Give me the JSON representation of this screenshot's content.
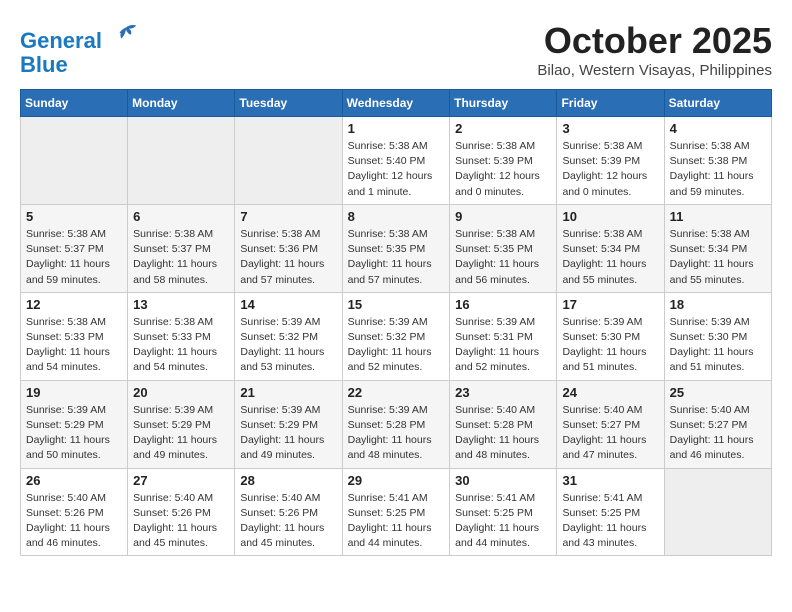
{
  "header": {
    "logo_line1": "General",
    "logo_line2": "Blue",
    "month": "October 2025",
    "location": "Bilao, Western Visayas, Philippines"
  },
  "weekdays": [
    "Sunday",
    "Monday",
    "Tuesday",
    "Wednesday",
    "Thursday",
    "Friday",
    "Saturday"
  ],
  "weeks": [
    [
      {
        "day": "",
        "info": ""
      },
      {
        "day": "",
        "info": ""
      },
      {
        "day": "",
        "info": ""
      },
      {
        "day": "1",
        "info": "Sunrise: 5:38 AM\nSunset: 5:40 PM\nDaylight: 12 hours\nand 1 minute."
      },
      {
        "day": "2",
        "info": "Sunrise: 5:38 AM\nSunset: 5:39 PM\nDaylight: 12 hours\nand 0 minutes."
      },
      {
        "day": "3",
        "info": "Sunrise: 5:38 AM\nSunset: 5:39 PM\nDaylight: 12 hours\nand 0 minutes."
      },
      {
        "day": "4",
        "info": "Sunrise: 5:38 AM\nSunset: 5:38 PM\nDaylight: 11 hours\nand 59 minutes."
      }
    ],
    [
      {
        "day": "5",
        "info": "Sunrise: 5:38 AM\nSunset: 5:37 PM\nDaylight: 11 hours\nand 59 minutes."
      },
      {
        "day": "6",
        "info": "Sunrise: 5:38 AM\nSunset: 5:37 PM\nDaylight: 11 hours\nand 58 minutes."
      },
      {
        "day": "7",
        "info": "Sunrise: 5:38 AM\nSunset: 5:36 PM\nDaylight: 11 hours\nand 57 minutes."
      },
      {
        "day": "8",
        "info": "Sunrise: 5:38 AM\nSunset: 5:35 PM\nDaylight: 11 hours\nand 57 minutes."
      },
      {
        "day": "9",
        "info": "Sunrise: 5:38 AM\nSunset: 5:35 PM\nDaylight: 11 hours\nand 56 minutes."
      },
      {
        "day": "10",
        "info": "Sunrise: 5:38 AM\nSunset: 5:34 PM\nDaylight: 11 hours\nand 55 minutes."
      },
      {
        "day": "11",
        "info": "Sunrise: 5:38 AM\nSunset: 5:34 PM\nDaylight: 11 hours\nand 55 minutes."
      }
    ],
    [
      {
        "day": "12",
        "info": "Sunrise: 5:38 AM\nSunset: 5:33 PM\nDaylight: 11 hours\nand 54 minutes."
      },
      {
        "day": "13",
        "info": "Sunrise: 5:38 AM\nSunset: 5:33 PM\nDaylight: 11 hours\nand 54 minutes."
      },
      {
        "day": "14",
        "info": "Sunrise: 5:39 AM\nSunset: 5:32 PM\nDaylight: 11 hours\nand 53 minutes."
      },
      {
        "day": "15",
        "info": "Sunrise: 5:39 AM\nSunset: 5:32 PM\nDaylight: 11 hours\nand 52 minutes."
      },
      {
        "day": "16",
        "info": "Sunrise: 5:39 AM\nSunset: 5:31 PM\nDaylight: 11 hours\nand 52 minutes."
      },
      {
        "day": "17",
        "info": "Sunrise: 5:39 AM\nSunset: 5:30 PM\nDaylight: 11 hours\nand 51 minutes."
      },
      {
        "day": "18",
        "info": "Sunrise: 5:39 AM\nSunset: 5:30 PM\nDaylight: 11 hours\nand 51 minutes."
      }
    ],
    [
      {
        "day": "19",
        "info": "Sunrise: 5:39 AM\nSunset: 5:29 PM\nDaylight: 11 hours\nand 50 minutes."
      },
      {
        "day": "20",
        "info": "Sunrise: 5:39 AM\nSunset: 5:29 PM\nDaylight: 11 hours\nand 49 minutes."
      },
      {
        "day": "21",
        "info": "Sunrise: 5:39 AM\nSunset: 5:29 PM\nDaylight: 11 hours\nand 49 minutes."
      },
      {
        "day": "22",
        "info": "Sunrise: 5:39 AM\nSunset: 5:28 PM\nDaylight: 11 hours\nand 48 minutes."
      },
      {
        "day": "23",
        "info": "Sunrise: 5:40 AM\nSunset: 5:28 PM\nDaylight: 11 hours\nand 48 minutes."
      },
      {
        "day": "24",
        "info": "Sunrise: 5:40 AM\nSunset: 5:27 PM\nDaylight: 11 hours\nand 47 minutes."
      },
      {
        "day": "25",
        "info": "Sunrise: 5:40 AM\nSunset: 5:27 PM\nDaylight: 11 hours\nand 46 minutes."
      }
    ],
    [
      {
        "day": "26",
        "info": "Sunrise: 5:40 AM\nSunset: 5:26 PM\nDaylight: 11 hours\nand 46 minutes."
      },
      {
        "day": "27",
        "info": "Sunrise: 5:40 AM\nSunset: 5:26 PM\nDaylight: 11 hours\nand 45 minutes."
      },
      {
        "day": "28",
        "info": "Sunrise: 5:40 AM\nSunset: 5:26 PM\nDaylight: 11 hours\nand 45 minutes."
      },
      {
        "day": "29",
        "info": "Sunrise: 5:41 AM\nSunset: 5:25 PM\nDaylight: 11 hours\nand 44 minutes."
      },
      {
        "day": "30",
        "info": "Sunrise: 5:41 AM\nSunset: 5:25 PM\nDaylight: 11 hours\nand 44 minutes."
      },
      {
        "day": "31",
        "info": "Sunrise: 5:41 AM\nSunset: 5:25 PM\nDaylight: 11 hours\nand 43 minutes."
      },
      {
        "day": "",
        "info": ""
      }
    ]
  ]
}
